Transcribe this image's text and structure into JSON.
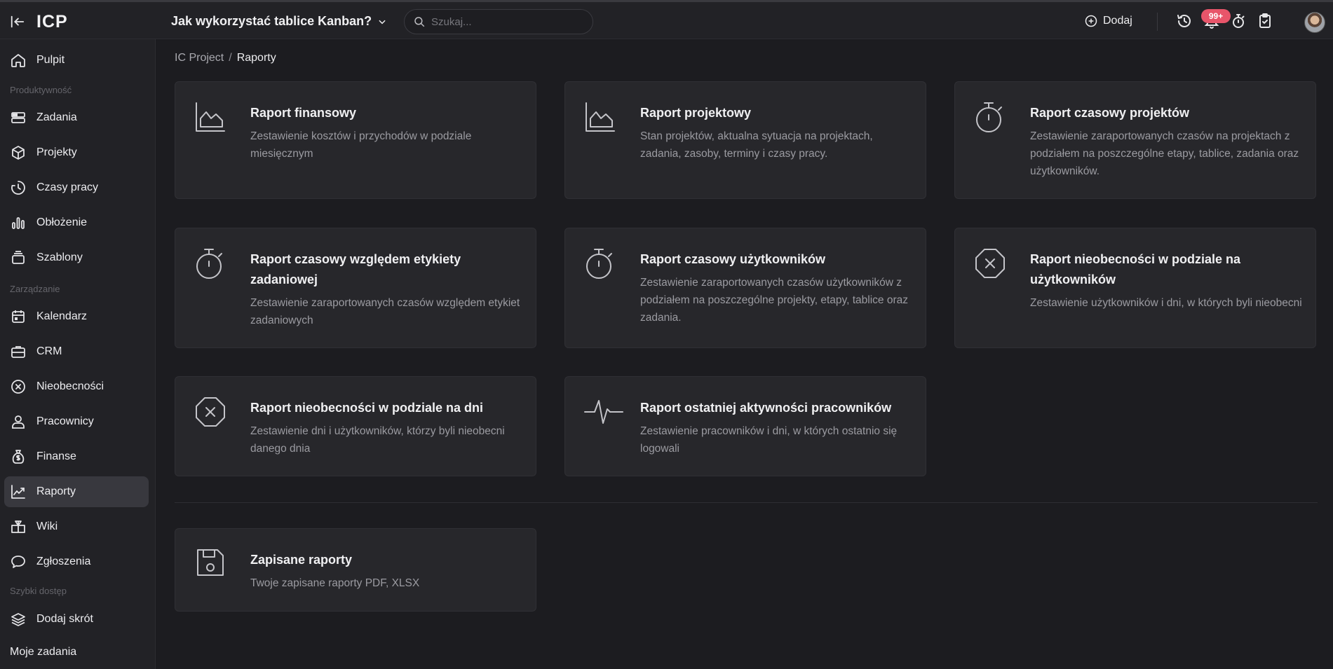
{
  "header": {
    "logo_text": "ICP",
    "project_title": "Jak wykorzystać tablice Kanban?",
    "search_placeholder": "Szukaj...",
    "add_label": "Dodaj",
    "notifications_badge": "99+"
  },
  "sidebar": {
    "pulpit": "Pulpit",
    "section_productivity": "Produktywność",
    "zadania": "Zadania",
    "projekty": "Projekty",
    "czasy_pracy": "Czasy pracy",
    "oblozenie": "Obłożenie",
    "szablony": "Szablony",
    "section_management": "Zarządzanie",
    "kalendarz": "Kalendarz",
    "crm": "CRM",
    "nieobecnosci": "Nieobecności",
    "pracownicy": "Pracownicy",
    "finanse": "Finanse",
    "raporty": "Raporty",
    "wiki": "Wiki",
    "zgloszenia": "Zgłoszenia",
    "section_quick": "Szybki dostęp",
    "dodaj_skrot": "Dodaj skrót",
    "moje_zadania": "Moje zadania"
  },
  "breadcrumb": {
    "root": "IC Project",
    "separator": "/",
    "current": "Raporty"
  },
  "reports": {
    "financial": {
      "title": "Raport finansowy",
      "desc": "Zestawienie kosztów i przychodów w podziale miesięcznym"
    },
    "project": {
      "title": "Raport projektowy",
      "desc": "Stan projektów, aktualna sytuacja na projektach, zadania, zasoby, terminy i czasy pracy."
    },
    "project_time": {
      "title": "Raport czasowy projektów",
      "desc": "Zestawienie zaraportowanych czasów na projektach z podziałem na poszczególne etapy, tablice, zadania oraz użytkowników."
    },
    "label_time": {
      "title": "Raport czasowy względem etykiety zadaniowej",
      "desc": "Zestawienie zaraportowanych czasów względem etykiet zadaniowych"
    },
    "user_time": {
      "title": "Raport czasowy użytkowników",
      "desc": "Zestawienie zaraportowanych czasów użytkowników z podziałem na poszczególne projekty, etapy, tablice oraz zadania."
    },
    "absence_users": {
      "title": "Raport nieobecności w podziale na użytkowników",
      "desc": "Zestawienie użytkowników i dni, w których byli nieobecni"
    },
    "absence_days": {
      "title": "Raport nieobecności w podziale na dni",
      "desc": "Zestawienie dni i użytkowników, którzy byli nieobecni danego dnia"
    },
    "activity": {
      "title": "Raport ostatniej aktywności pracowników",
      "desc": "Zestawienie pracowników i dni, w których ostatnio się logowali"
    },
    "saved": {
      "title": "Zapisane raporty",
      "desc": "Twoje zapisane raporty PDF, XLSX"
    }
  }
}
